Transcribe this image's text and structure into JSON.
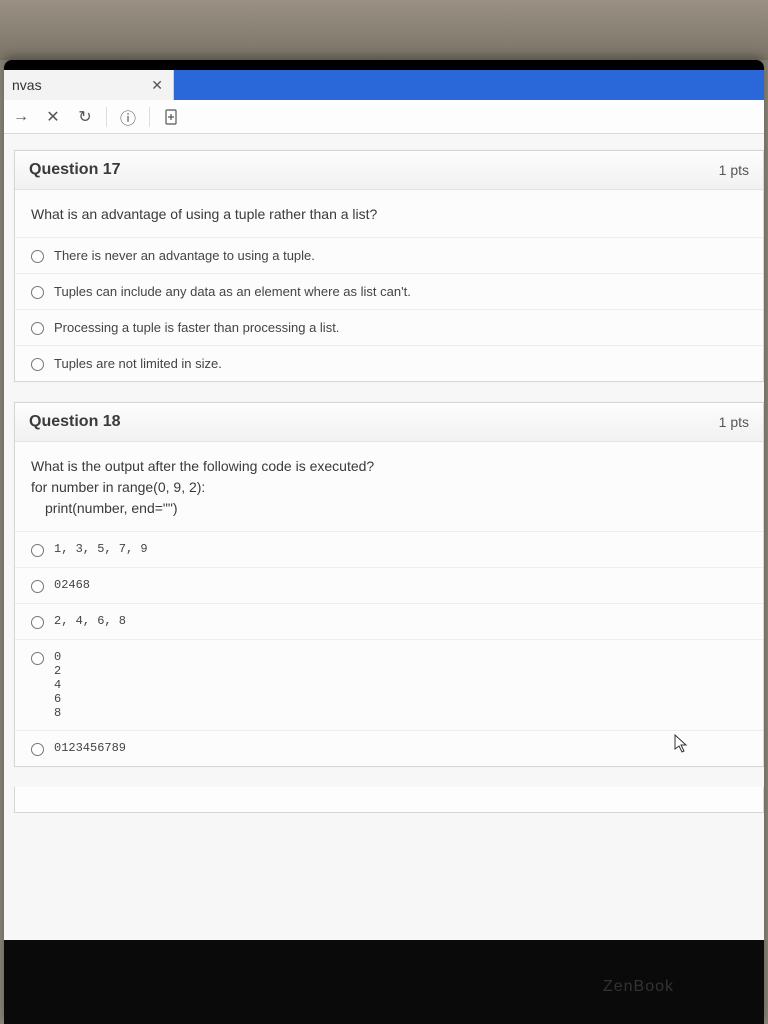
{
  "browser": {
    "tab_title": "nvas"
  },
  "q17": {
    "title": "Question 17",
    "pts": "1 pts",
    "prompt": "What is an advantage of using a tuple rather than a list?",
    "answers": [
      "There is never an advantage to using a tuple.",
      "Tuples can include any data as an element where as list can't.",
      "Processing a tuple is faster than processing a list.",
      "Tuples are not limited in size."
    ]
  },
  "q18": {
    "title": "Question 18",
    "pts": "1 pts",
    "prompt_line1": "What is the output after the following code is executed?",
    "prompt_line2": "for number in range(0, 9, 2):",
    "prompt_line3": "print(number, end=\"\")",
    "answers": [
      "1, 3, 5, 7, 9",
      "02468",
      "2, 4, 6, 8",
      "0\n2\n4\n6\n8",
      "0123456789"
    ]
  },
  "brand": "ZenBook"
}
